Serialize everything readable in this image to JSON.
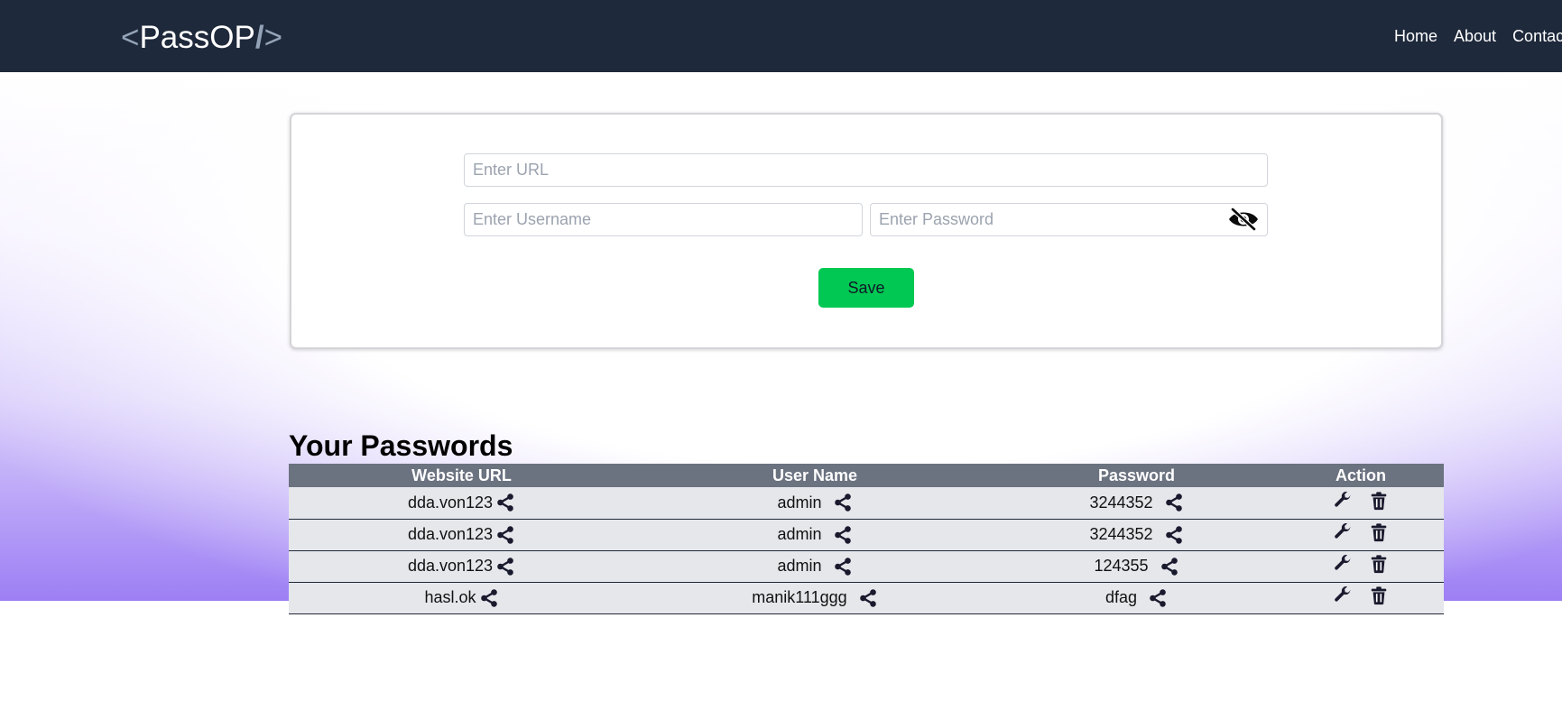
{
  "header": {
    "logo_open": "<",
    "logo_text": "PassOP",
    "logo_slash": "/",
    "logo_close": ">",
    "nav": [
      "Home",
      "About",
      "Contact"
    ]
  },
  "form": {
    "url_placeholder": "Enter URL",
    "username_placeholder": "Enter Username",
    "password_placeholder": "Enter Password",
    "toggle_icon": "eye-slash-icon",
    "save_label": "Save"
  },
  "passwords": {
    "title": "Your Passwords",
    "columns": [
      "Website URL",
      "User Name",
      "Password",
      "Action"
    ],
    "rows": [
      {
        "site": "dda.von123",
        "user": "admin",
        "password": "3244352"
      },
      {
        "site": "dda.von123",
        "user": "admin",
        "password": "3244352"
      },
      {
        "site": "dda.von123",
        "user": "admin",
        "password": "124355"
      },
      {
        "site": "hasl.ok",
        "user": "manik111ggg",
        "password": "dfag"
      }
    ]
  },
  "colors": {
    "navbar": "#1e293b",
    "save_button": "#00c853",
    "table_header": "#6b7280",
    "table_row": "#e5e7eb",
    "gradient_bottom": "#9d7ff4"
  }
}
